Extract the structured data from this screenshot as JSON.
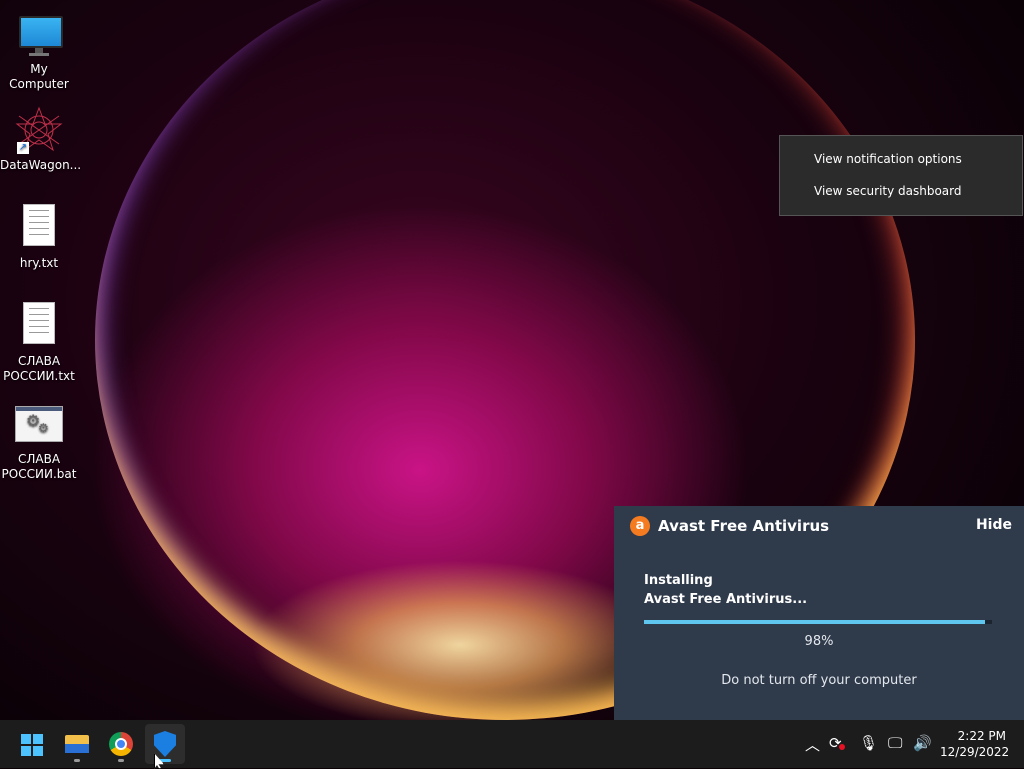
{
  "desktop": {
    "icons": [
      {
        "label": "My Computer",
        "icon": "monitor-icon"
      },
      {
        "label": "DataWagon...",
        "icon": "datawagon-icon"
      },
      {
        "label": "hry.txt",
        "icon": "text-file-icon"
      },
      {
        "label": "СЛАВА РОССИИ.txt",
        "icon": "text-file-icon"
      },
      {
        "label": "СЛАВА РОССИИ.bat",
        "icon": "batch-file-icon"
      }
    ]
  },
  "context_menu": {
    "items": [
      "View notification options",
      "View security dashboard"
    ]
  },
  "avast": {
    "title": "Avast Free Antivirus",
    "hide_label": "Hide",
    "status_line1": "Installing",
    "status_line2": "Avast Free Antivirus...",
    "progress_percent": 98,
    "progress_text": "98%",
    "note": "Do not turn off your computer",
    "accent_color": "#f57b20",
    "progress_color": "#5fc6f0"
  },
  "taskbar": {
    "apps": [
      {
        "name": "start-button",
        "icon": "windows-icon"
      },
      {
        "name": "file-explorer",
        "icon": "folder-icon"
      },
      {
        "name": "chrome",
        "icon": "chrome-icon"
      },
      {
        "name": "windows-security",
        "icon": "shield-icon"
      }
    ],
    "tray": [
      "chevron-up-icon",
      "sync-icon",
      "microphone-icon",
      "network-icon",
      "volume-icon"
    ],
    "time": "2:22 PM",
    "date": "12/29/2022"
  }
}
